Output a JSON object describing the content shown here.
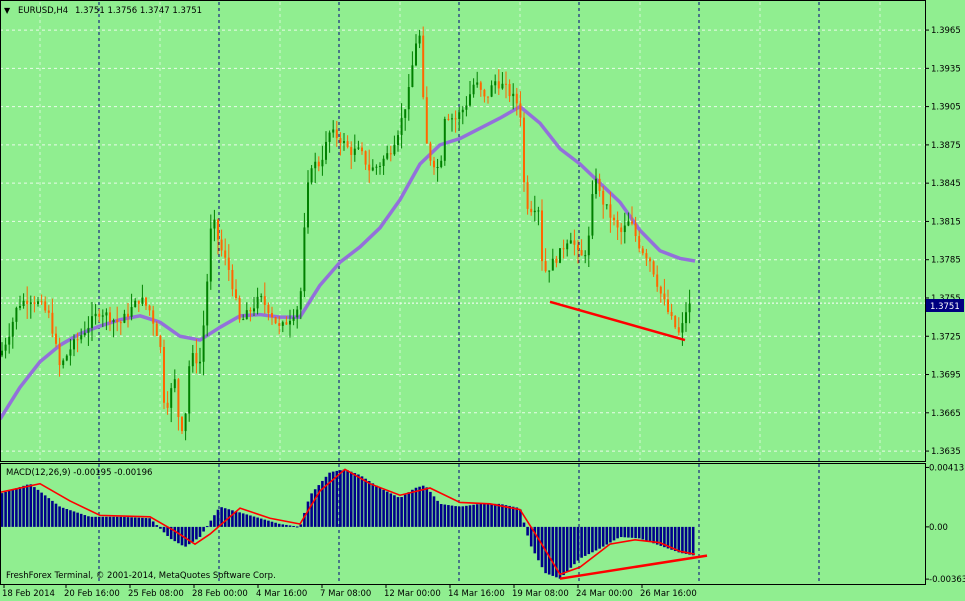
{
  "header": {
    "symbol_label": "EURUSD,H4",
    "ohlc": "1.3751 1.3756 1.3747 1.3751"
  },
  "macd": {
    "label": "MACD(12,26,9) -0.00195 -0.00196"
  },
  "footer": {
    "copyright": "FreshForex Terminal, © 2001-2014, MetaQuotes Software Corp."
  },
  "colors": {
    "background": "#90ee90",
    "grid": "#ffffff",
    "bull_candle": "#008000",
    "bear_candle": "#ff6600",
    "ma_line": "#9370db",
    "macd_histogram": "#00008b",
    "signal_line": "#ff0000",
    "trend_line": "#ff0000",
    "price_tag": "#000080"
  },
  "chart_data": [
    {
      "type": "candlestick",
      "title": "EURUSD,H4",
      "x_ticks": [
        "18 Feb 2014",
        "20 Feb 16:00",
        "25 Feb 08:00",
        "28 Feb 00:00",
        "4 Mar 16:00",
        "7 Mar 08:00",
        "12 Mar 00:00",
        "14 Mar 16:00",
        "19 Mar 08:00",
        "24 Mar 00:00",
        "26 Mar 16:00"
      ],
      "y_ticks": [
        "1.3965",
        "1.3935",
        "1.3905",
        "1.3875",
        "1.3845",
        "1.3815",
        "1.3785",
        "1.3755",
        "1.3725",
        "1.3695",
        "1.3665",
        "1.3635"
      ],
      "ylim": [
        1.3628,
        1.3987
      ],
      "current_price": "1.3751",
      "moving_average": [
        [
          0,
          1.366
        ],
        [
          20,
          1.3685
        ],
        [
          40,
          1.3705
        ],
        [
          60,
          1.3718
        ],
        [
          80,
          1.3727
        ],
        [
          100,
          1.3733
        ],
        [
          120,
          1.3738
        ],
        [
          140,
          1.3741
        ],
        [
          160,
          1.3736
        ],
        [
          180,
          1.3725
        ],
        [
          200,
          1.3722
        ],
        [
          220,
          1.3732
        ],
        [
          240,
          1.3741
        ],
        [
          260,
          1.3742
        ],
        [
          280,
          1.374
        ],
        [
          300,
          1.374
        ],
        [
          320,
          1.3765
        ],
        [
          340,
          1.3783
        ],
        [
          360,
          1.3795
        ],
        [
          380,
          1.381
        ],
        [
          400,
          1.3832
        ],
        [
          420,
          1.386
        ],
        [
          440,
          1.3875
        ],
        [
          460,
          1.388
        ],
        [
          480,
          1.3888
        ],
        [
          500,
          1.3896
        ],
        [
          520,
          1.3905
        ],
        [
          540,
          1.3892
        ],
        [
          560,
          1.3872
        ],
        [
          580,
          1.386
        ],
        [
          600,
          1.3845
        ],
        [
          620,
          1.383
        ],
        [
          640,
          1.3808
        ],
        [
          660,
          1.3792
        ],
        [
          680,
          1.3786
        ],
        [
          695,
          1.3784
        ]
      ],
      "candles_keypoints": [
        [
          0,
          1.371
        ],
        [
          8,
          1.3725
        ],
        [
          18,
          1.375
        ],
        [
          30,
          1.3755
        ],
        [
          40,
          1.375
        ],
        [
          50,
          1.374
        ],
        [
          60,
          1.37
        ],
        [
          70,
          1.3715
        ],
        [
          80,
          1.3725
        ],
        [
          90,
          1.3735
        ],
        [
          100,
          1.3745
        ],
        [
          110,
          1.374
        ],
        [
          120,
          1.3735
        ],
        [
          130,
          1.3745
        ],
        [
          140,
          1.3755
        ],
        [
          150,
          1.3745
        ],
        [
          160,
          1.372
        ],
        [
          165,
          1.3665
        ],
        [
          170,
          1.368
        ],
        [
          175,
          1.369
        ],
        [
          180,
          1.365
        ],
        [
          185,
          1.366
        ],
        [
          190,
          1.371
        ],
        [
          200,
          1.3705
        ],
        [
          205,
          1.3745
        ],
        [
          212,
          1.382
        ],
        [
          220,
          1.3795
        ],
        [
          230,
          1.3775
        ],
        [
          240,
          1.3735
        ],
        [
          250,
          1.3745
        ],
        [
          260,
          1.3755
        ],
        [
          270,
          1.3745
        ],
        [
          280,
          1.373
        ],
        [
          290,
          1.374
        ],
        [
          300,
          1.375
        ],
        [
          305,
          1.3815
        ],
        [
          310,
          1.386
        ],
        [
          320,
          1.386
        ],
        [
          330,
          1.3885
        ],
        [
          340,
          1.388
        ],
        [
          350,
          1.387
        ],
        [
          360,
          1.387
        ],
        [
          370,
          1.3855
        ],
        [
          380,
          1.386
        ],
        [
          390,
          1.387
        ],
        [
          400,
          1.389
        ],
        [
          410,
          1.392
        ],
        [
          415,
          1.3955
        ],
        [
          420,
          1.396
        ],
        [
          425,
          1.388
        ],
        [
          430,
          1.3865
        ],
        [
          440,
          1.3855
        ],
        [
          445,
          1.39
        ],
        [
          455,
          1.3895
        ],
        [
          465,
          1.3905
        ],
        [
          475,
          1.3925
        ],
        [
          485,
          1.391
        ],
        [
          495,
          1.3925
        ],
        [
          505,
          1.392
        ],
        [
          515,
          1.391
        ],
        [
          520,
          1.3905
        ],
        [
          525,
          1.383
        ],
        [
          532,
          1.3825
        ],
        [
          538,
          1.383
        ],
        [
          543,
          1.3775
        ],
        [
          550,
          1.378
        ],
        [
          560,
          1.379
        ],
        [
          570,
          1.3805
        ],
        [
          580,
          1.3785
        ],
        [
          588,
          1.3795
        ],
        [
          595,
          1.3855
        ],
        [
          600,
          1.3835
        ],
        [
          610,
          1.382
        ],
        [
          620,
          1.3805
        ],
        [
          630,
          1.3815
        ],
        [
          640,
          1.3795
        ],
        [
          650,
          1.3785
        ],
        [
          660,
          1.376
        ],
        [
          670,
          1.374
        ],
        [
          680,
          1.3725
        ],
        [
          686,
          1.3745
        ],
        [
          692,
          1.3751
        ]
      ],
      "trend_line": [
        [
          550,
          1.3752
        ],
        [
          685,
          1.3722
        ]
      ]
    },
    {
      "type": "bar",
      "title": "MACD(12,26,9) -0.00195 -0.00196",
      "y_ticks": [
        "0.00413",
        "0.00",
        "-0.00363"
      ],
      "ylim": [
        -0.0039,
        0.0043
      ],
      "histogram_keypoints": [
        [
          0,
          0.0023
        ],
        [
          30,
          0.003
        ],
        [
          60,
          0.0014
        ],
        [
          90,
          0.0007
        ],
        [
          120,
          0.0007
        ],
        [
          150,
          0.0006
        ],
        [
          170,
          -0.0008
        ],
        [
          185,
          -0.0014
        ],
        [
          200,
          -0.0007
        ],
        [
          220,
          0.0014
        ],
        [
          240,
          0.001
        ],
        [
          260,
          0.0006
        ],
        [
          280,
          0.0002
        ],
        [
          300,
          0.0
        ],
        [
          310,
          0.0022
        ],
        [
          330,
          0.0038
        ],
        [
          345,
          0.004
        ],
        [
          360,
          0.0036
        ],
        [
          380,
          0.0027
        ],
        [
          400,
          0.002
        ],
        [
          415,
          0.0027
        ],
        [
          425,
          0.0029
        ],
        [
          440,
          0.0016
        ],
        [
          460,
          0.0014
        ],
        [
          480,
          0.0016
        ],
        [
          500,
          0.0016
        ],
        [
          520,
          0.0013
        ],
        [
          530,
          -0.0012
        ],
        [
          545,
          -0.0032
        ],
        [
          560,
          -0.0036
        ],
        [
          580,
          -0.0022
        ],
        [
          600,
          -0.0015
        ],
        [
          620,
          -0.0007
        ],
        [
          640,
          -0.0008
        ],
        [
          660,
          -0.0013
        ],
        [
          680,
          -0.0018
        ],
        [
          695,
          -0.002
        ]
      ],
      "signal_keypoints": [
        [
          0,
          0.0024
        ],
        [
          40,
          0.003
        ],
        [
          70,
          0.0018
        ],
        [
          100,
          0.0008
        ],
        [
          150,
          0.0007
        ],
        [
          175,
          -0.0003
        ],
        [
          195,
          -0.0012
        ],
        [
          210,
          -0.0005
        ],
        [
          240,
          0.0013
        ],
        [
          270,
          0.0006
        ],
        [
          300,
          0.0002
        ],
        [
          320,
          0.0025
        ],
        [
          345,
          0.004
        ],
        [
          370,
          0.003
        ],
        [
          400,
          0.0022
        ],
        [
          430,
          0.0027
        ],
        [
          460,
          0.0017
        ],
        [
          490,
          0.0016
        ],
        [
          520,
          0.0012
        ],
        [
          540,
          -0.001
        ],
        [
          560,
          -0.0033
        ],
        [
          580,
          -0.0028
        ],
        [
          610,
          -0.0012
        ],
        [
          635,
          -0.0009
        ],
        [
          660,
          -0.0011
        ],
        [
          680,
          -0.0017
        ],
        [
          695,
          -0.0019
        ]
      ],
      "trend_line": [
        [
          560,
          -0.0036
        ],
        [
          707,
          -0.002
        ]
      ]
    }
  ]
}
